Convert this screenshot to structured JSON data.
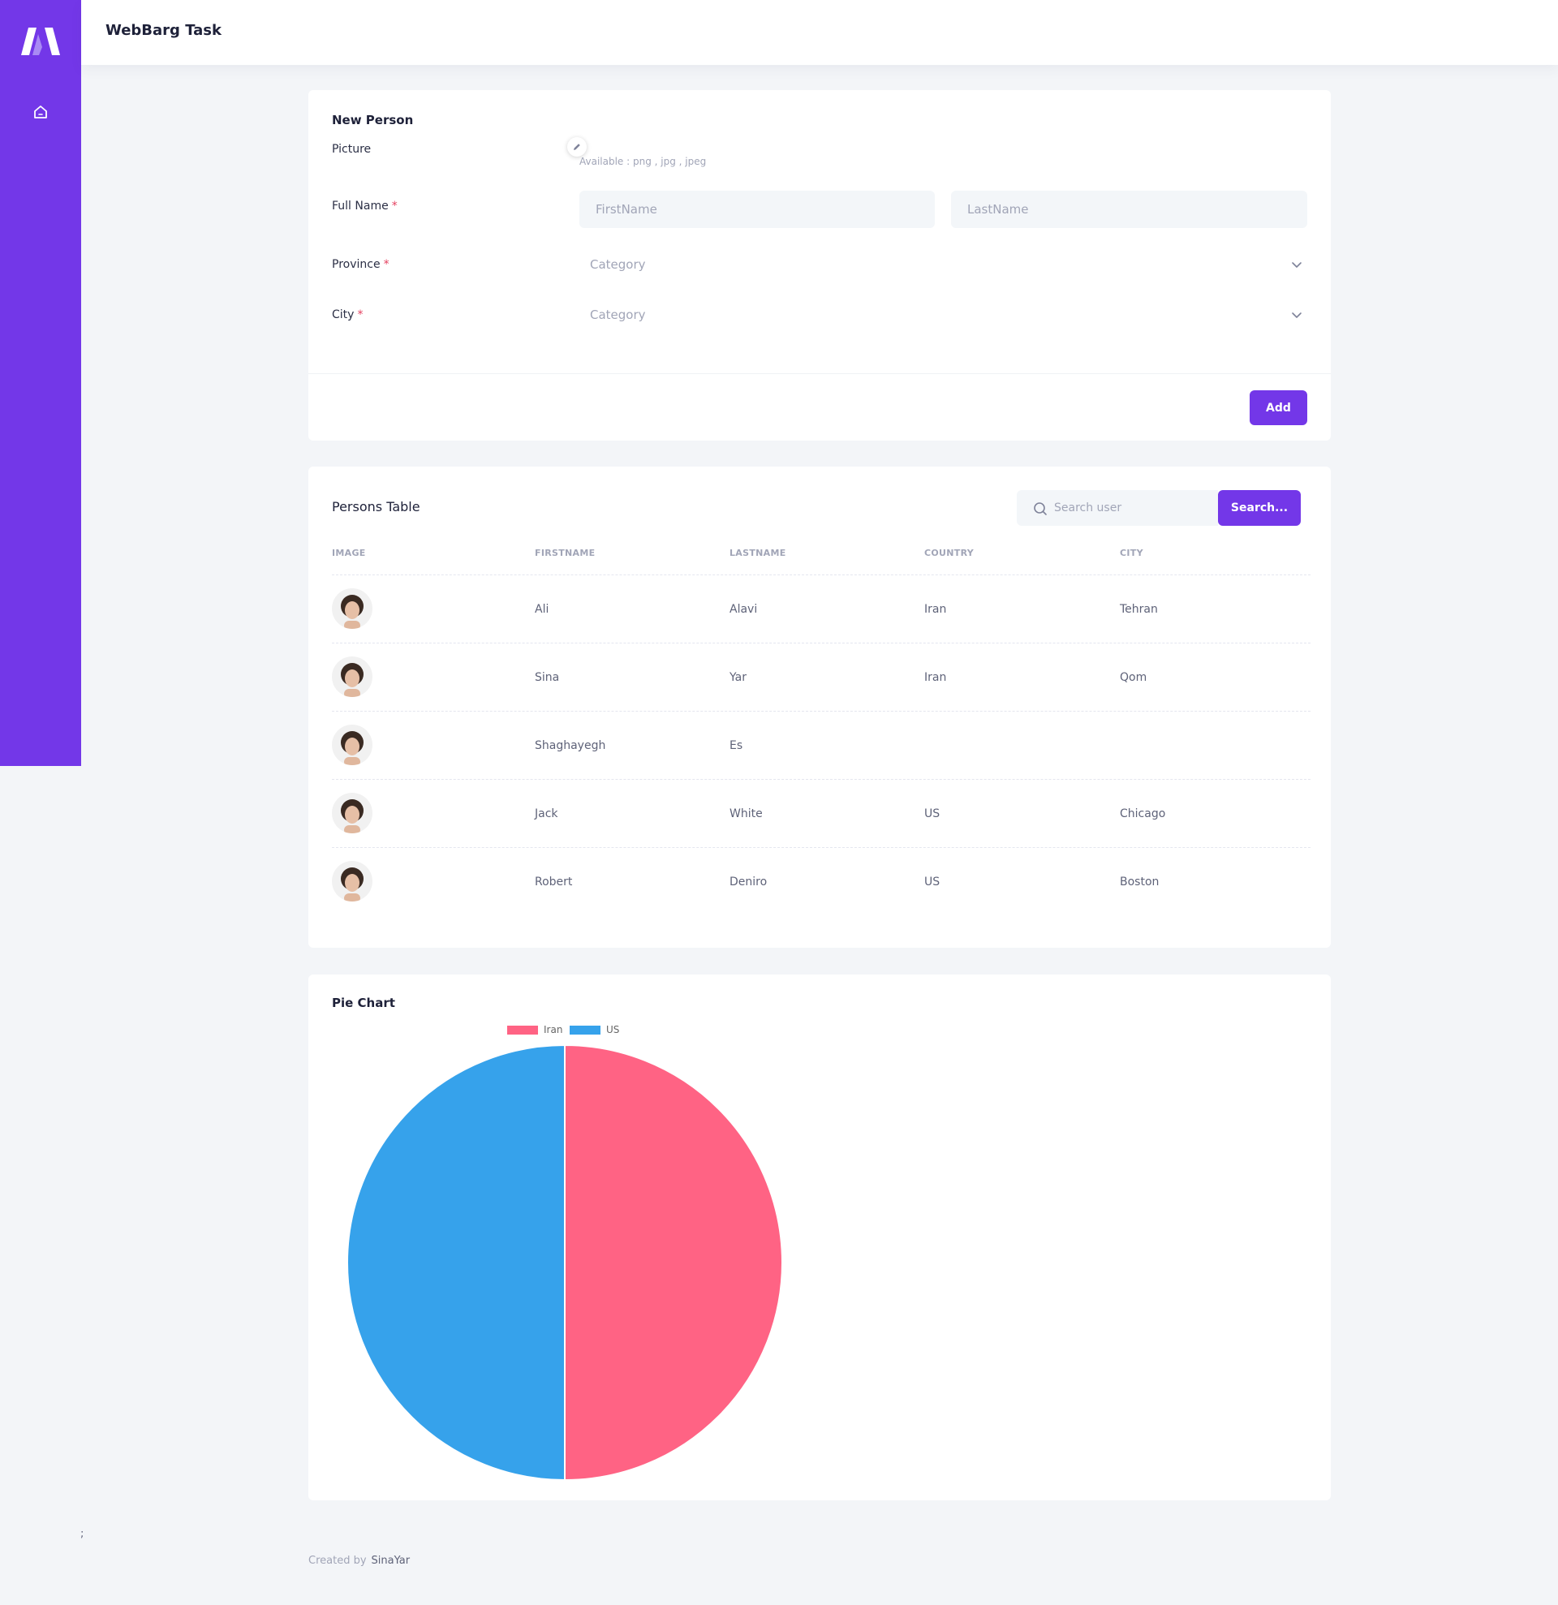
{
  "header": {
    "title": "WebBarg Task"
  },
  "sidebar": {
    "logo": "logo-icon",
    "home_icon": "home-icon"
  },
  "form": {
    "title": "New Person",
    "picture_label": "Picture",
    "picture_hint": "Available : png , jpg , jpeg",
    "fullname_label": "Full Name",
    "required_mark": "*",
    "firstname_placeholder": "FirstName",
    "lastname_placeholder": "LastName",
    "province_label": "Province",
    "province_value": "Category",
    "city_label": "City",
    "city_value": "Category",
    "add_label": "Add"
  },
  "table": {
    "title": "Persons Table",
    "search_placeholder": "Search user",
    "search_button": "Search...",
    "columns": [
      "IMAGE",
      "FIRSTNAME",
      "LASTNAME",
      "COUNTRY",
      "CITY"
    ],
    "rows": [
      {
        "firstname": "Ali",
        "lastname": "Alavi",
        "country": "Iran",
        "city": "Tehran"
      },
      {
        "firstname": "Sina",
        "lastname": "Yar",
        "country": "Iran",
        "city": "Qom"
      },
      {
        "firstname": "Shaghayegh",
        "lastname": "Es",
        "country": "",
        "city": ""
      },
      {
        "firstname": "Jack",
        "lastname": "White",
        "country": "US",
        "city": "Chicago"
      },
      {
        "firstname": "Robert",
        "lastname": "Deniro",
        "country": "US",
        "city": "Boston"
      }
    ]
  },
  "chart": {
    "title": "Pie Chart"
  },
  "chart_data": {
    "type": "pie",
    "categories": [
      "Iran",
      "US"
    ],
    "values": [
      2,
      2
    ],
    "colors": [
      "#ff6384",
      "#36a2eb"
    ],
    "legend": "top"
  },
  "footer": {
    "semicolon": ";",
    "created_by": "Created by",
    "author": "SinaYar"
  },
  "colors": {
    "accent": "#7337e8",
    "background": "#f3f5f8"
  }
}
